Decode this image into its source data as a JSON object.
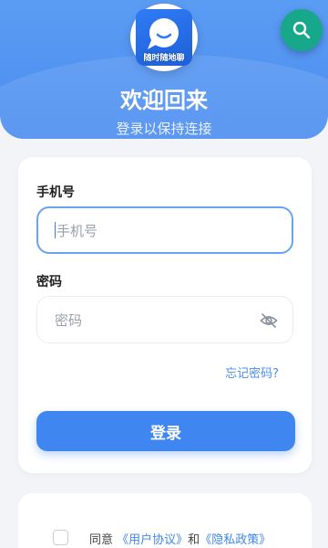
{
  "header": {
    "logo_text": "随时随地聊",
    "title": "欢迎回来",
    "subtitle": "登录以保持连接",
    "search_icon": "search-icon"
  },
  "form": {
    "phone_label": "手机号",
    "phone_placeholder": "手机号",
    "password_label": "密码",
    "password_placeholder": "密码",
    "forgot_link": "忘记密码?",
    "login_button": "登录",
    "password_toggle_icon": "eye-off-icon"
  },
  "agreement": {
    "prefix": "同意",
    "user_agreement": "《用户协议》",
    "and": "和",
    "privacy_policy": "《隐私政策》"
  },
  "colors": {
    "primary": "#3f86f0",
    "header": "#4a8cf0",
    "fab": "#17a78a"
  }
}
